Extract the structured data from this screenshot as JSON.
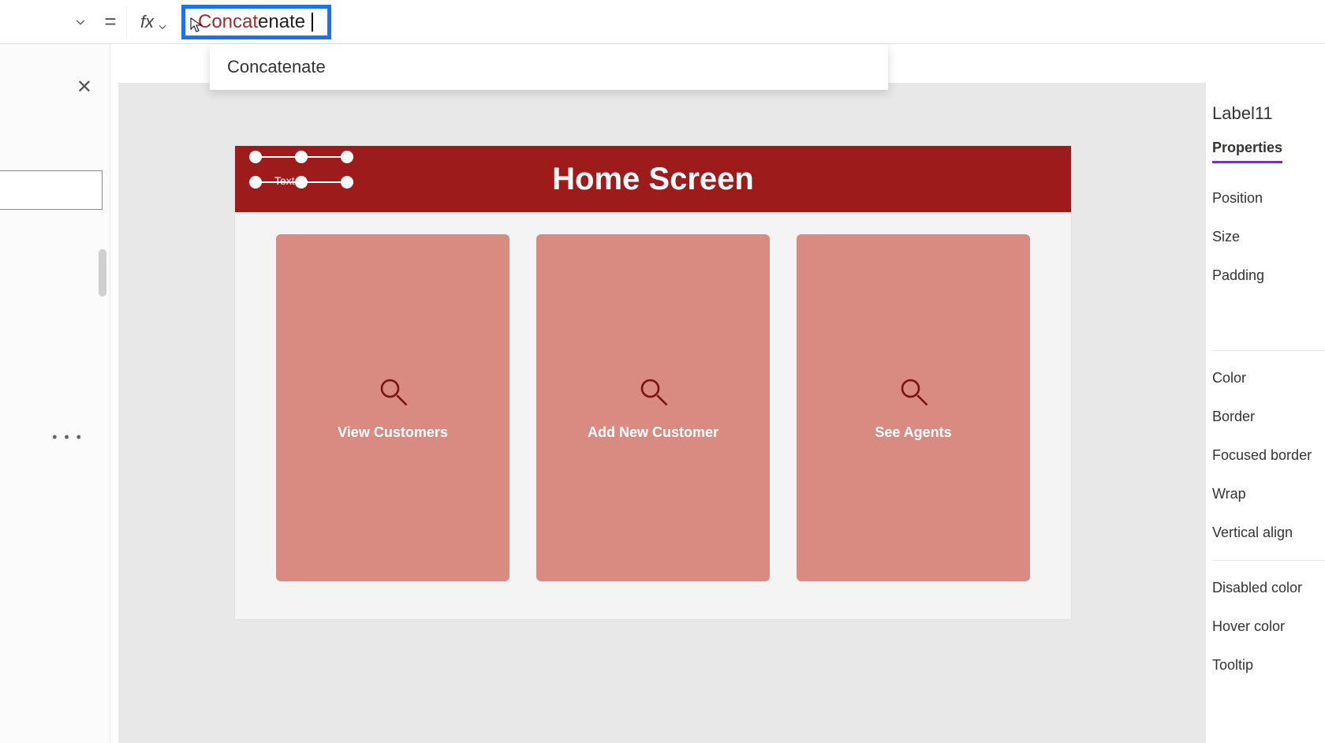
{
  "formula_bar": {
    "equals": "=",
    "fx_label": "fx",
    "input_matched": "Concat",
    "input_rest": "enate",
    "suggestion": "Concatenate"
  },
  "left_panel": {
    "close": "✕",
    "more": "• • •"
  },
  "canvas": {
    "header_title": "Home Screen",
    "selected_label_text": "Text",
    "cards": [
      {
        "label": "View Customers"
      },
      {
        "label": "Add New Customer"
      },
      {
        "label": "See Agents"
      }
    ]
  },
  "right_panel": {
    "control_name": "Label11",
    "tab": "Properties",
    "props": [
      "Position",
      "Size",
      "Padding",
      "Color",
      "Border",
      "Focused border",
      "Wrap",
      "Vertical align",
      "Disabled color",
      "Hover color",
      "Tooltip"
    ]
  }
}
